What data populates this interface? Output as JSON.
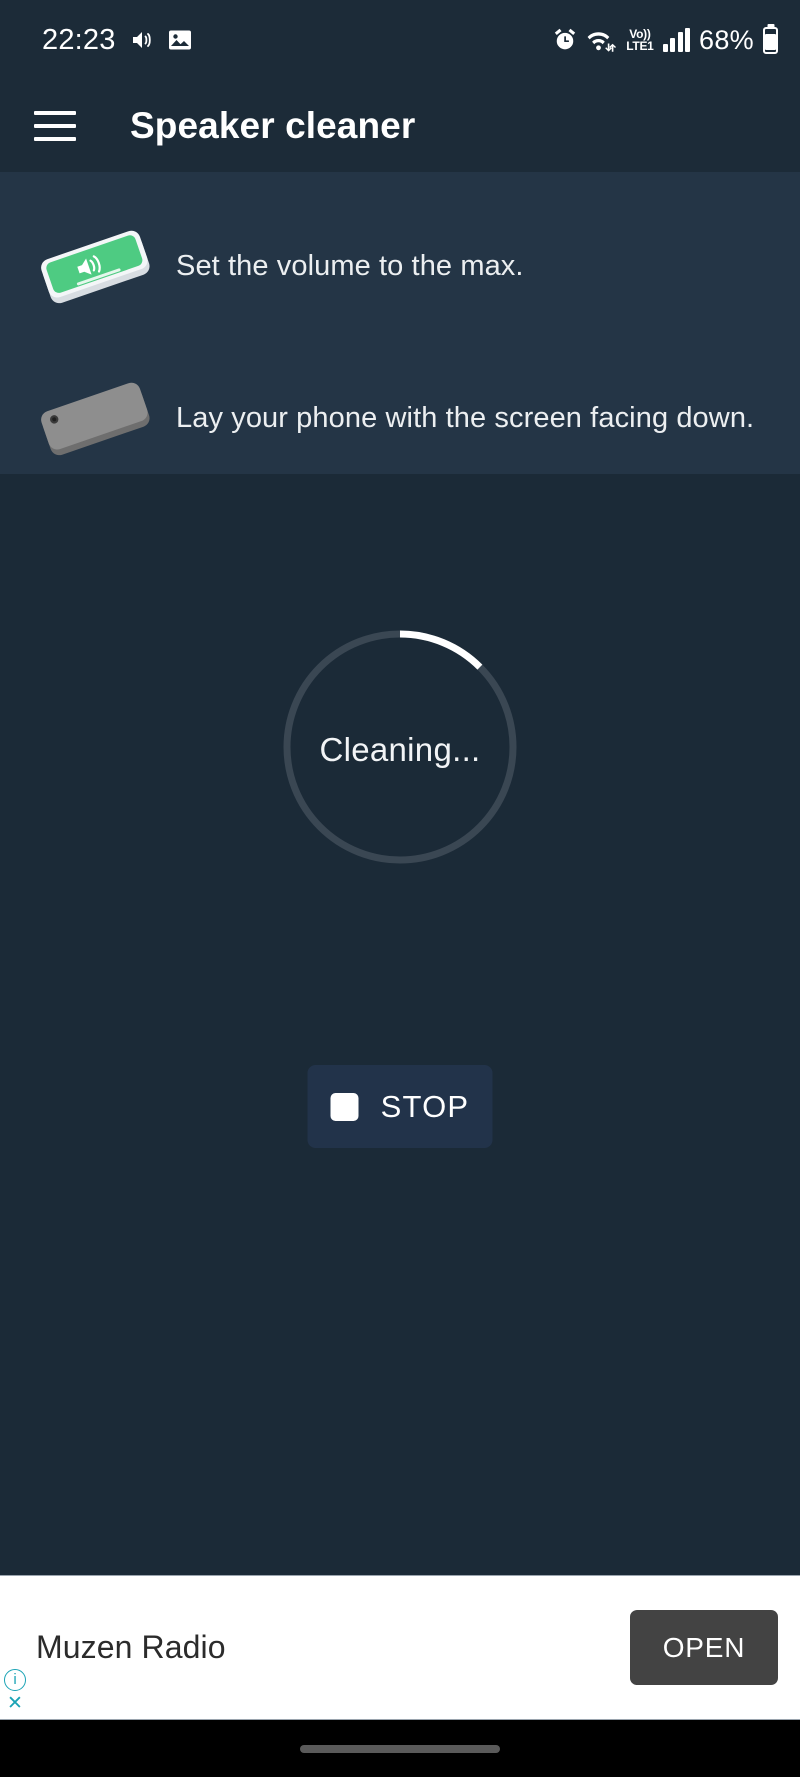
{
  "status_bar": {
    "clock": "22:23",
    "battery_percent": "68%",
    "volte_top": "Vo))",
    "volte_bottom": "LTE1",
    "icons": [
      "volume-icon",
      "gallery-icon",
      "alarm-icon",
      "wifi-icon",
      "volte-icon",
      "signal-icon",
      "battery-icon"
    ]
  },
  "app_bar": {
    "menu_icon": "hamburger-menu-icon",
    "title": "Speaker cleaner"
  },
  "instructions": [
    {
      "icon": "green-phone-speaker-icon",
      "text": "Set the volume to the max."
    },
    {
      "icon": "gray-phone-back-icon",
      "text": "Lay your phone with the screen facing down."
    }
  ],
  "progress": {
    "label": "Cleaning...",
    "percent": 18,
    "track_color": "#3a4753",
    "arc_color": "#ffffff"
  },
  "stop_button": {
    "label": "STOP",
    "icon": "stop-square-icon",
    "background_color": "#22334a"
  },
  "ad": {
    "title": "Muzen Radio",
    "open_label": "OPEN",
    "info_icon": "i",
    "close_icon": "✕",
    "accent_color": "#1aa3b5"
  },
  "theme": {
    "app_background": "#1b2a37",
    "panel_background": "#243546",
    "bar_background": "#1c2b38",
    "accent_green": "#4ecb82"
  }
}
